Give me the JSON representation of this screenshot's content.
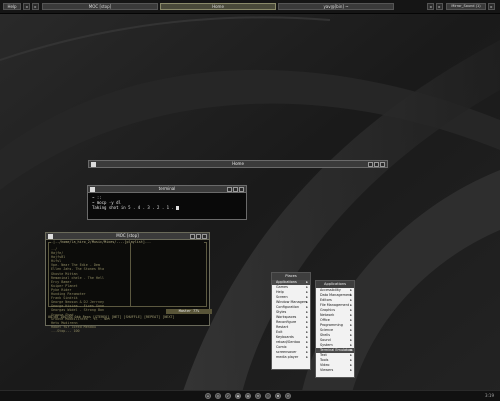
{
  "colors": {
    "desktop": "#1c1c1c",
    "accent": "#8a8a6a",
    "moc_text": "#8f8a62"
  },
  "top_panel": {
    "left_button": "Help",
    "task_moc": "MOC [stop]",
    "task_home": "Home",
    "task_user": "yav@[bin] ~",
    "right_task": "Mirror_Sound (1)"
  },
  "empty_window": {
    "title": "Home"
  },
  "terminal": {
    "title": "terminal",
    "lines": [
      "~ ::",
      "~ mocp -y dl",
      "Taking shot in 5 . 4 . 3 . 2 . 1 ."
    ]
  },
  "moc": {
    "title": "MOC [stop]",
    "header": "-|--/home/la_hiro_2/Music/Mixes/----[playlist]---",
    "files": [
      "../",
      "Hajfe/",
      "HajfsBl",
      "Hifsl",
      "Vpe- Near The Edie - Dem",
      "Ellen Jahs- The Stones Rta",
      "Ghoste Mittan",
      "Remaninal chele - The Hell",
      "Ercy Bamer",
      "Kuiper Planet",
      "Pyke Rider",
      " Hunding Paromoter",
      "Frank Sindrik",
      "George Neoson & DJ Jerrney",
      "George Hisiea - Fixes Gone",
      "Georgas Widel - Strong Bon",
      "Groove Shed",
      "Groove Moddilintes - El - Net",
      "Hetu Mudirenn",
      "Habet fur lored Mendou",
      "---Stop--- 100"
    ],
    "status_master": "Master  77%",
    "status_line1": "00:00        100:00      0kb     Reps [STEREO] [NET] [SHUFFLE] [REPEAT] [NEXT]",
    "status_line2": "---[Stop]--- 100"
  },
  "places_menu": {
    "title": "Places",
    "items": [
      "Applications",
      "Games",
      "Help",
      "Screen",
      "Window Managers",
      "Configuration",
      "Styles",
      "Workspaces",
      "Reconfigure",
      "Restart",
      "Exit",
      "Keyboards",
      "reload/Gentoo",
      "Comix",
      "screensaver",
      "media player"
    ]
  },
  "apps_menu": {
    "title": "Applications",
    "items": [
      "Accessibility",
      "Data Management",
      "Editors",
      "File Management",
      "Graphics",
      "Network",
      "Office",
      "Programming",
      "Science",
      "Shells",
      "Sound",
      "System",
      "Terminal Emulators",
      "Text",
      "Tools",
      "Video",
      "Viewers"
    ]
  },
  "taskbar": {
    "icons": [
      "home-icon",
      "globe-icon",
      "music-icon",
      "terminal-icon",
      "folder-icon",
      "mail-icon",
      "chat-icon",
      "settings-icon",
      "power-icon"
    ],
    "clock": "3:19"
  }
}
